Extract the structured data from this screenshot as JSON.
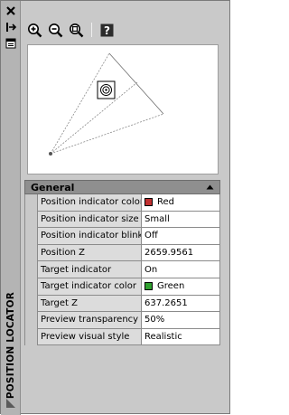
{
  "window": {
    "title": "POSITION LOCATOR"
  },
  "icons": {
    "close": "close-icon",
    "autohide": "autohide-icon",
    "properties": "properties-icon",
    "zoom_in": "zoom-in-icon",
    "zoom_out": "zoom-out-icon",
    "zoom_extents": "zoom-extents-icon",
    "help": "help-icon",
    "collapse": "collapse-triangle-icon",
    "corner": "corner-triangle-icon"
  },
  "properties": {
    "section_label": "General",
    "rows": [
      {
        "name": "Position indicator color",
        "value": "Red",
        "swatch": "#c03030"
      },
      {
        "name": "Position indicator size",
        "value": "Small"
      },
      {
        "name": "Position indicator blink",
        "value": "Off"
      },
      {
        "name": "Position Z",
        "value": "2659.9561"
      },
      {
        "name": "Target indicator",
        "value": "On"
      },
      {
        "name": "Target indicator color",
        "value": "Green",
        "swatch": "#30a030"
      },
      {
        "name": "Target Z",
        "value": "637.2651"
      },
      {
        "name": "Preview transparency",
        "value": "50%"
      },
      {
        "name": "Preview visual style",
        "value": "Realistic"
      }
    ]
  }
}
